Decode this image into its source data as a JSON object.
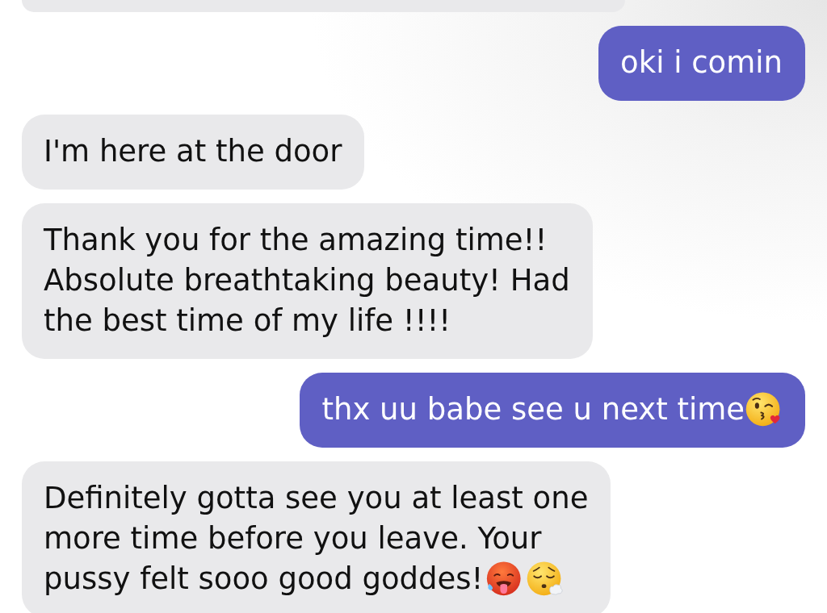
{
  "messages": [
    {
      "outgoing": false,
      "kind": "clipped"
    },
    {
      "outgoing": true,
      "kind": "text",
      "lines": [
        "oki i comin"
      ]
    },
    {
      "outgoing": false,
      "kind": "text",
      "lines": [
        "I'm here at the door"
      ]
    },
    {
      "outgoing": false,
      "kind": "text",
      "lines": [
        "Thank you for the amazing time!!",
        "Absolute breathtaking beauty! Had",
        "the best time of my life !!!!"
      ]
    },
    {
      "outgoing": true,
      "kind": "kiss",
      "lines": [
        "thx uu babe see u next time"
      ]
    },
    {
      "outgoing": false,
      "kind": "flustered",
      "lines": [
        "Definitely gotta see you at least one",
        "more time before you leave. Your",
        "pussy felt sooo good goddes!"
      ]
    }
  ]
}
